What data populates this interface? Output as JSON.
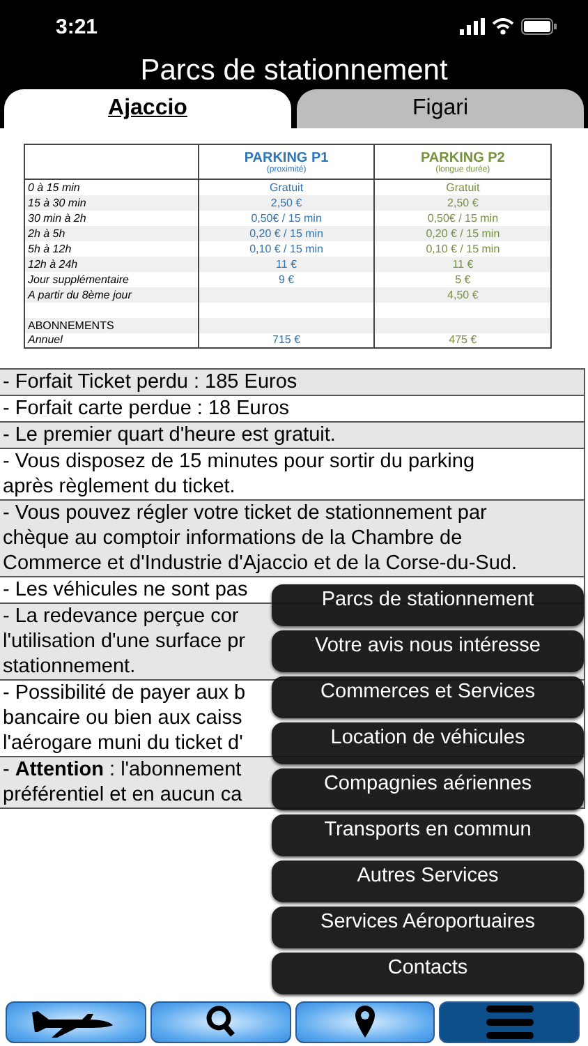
{
  "status_bar": {
    "time": "3:21"
  },
  "header": {
    "title": "Parcs de stationnement"
  },
  "tabs": [
    {
      "label": "Ajaccio",
      "selected": true
    },
    {
      "label": "Figari",
      "selected": false
    }
  ],
  "tariff_table": {
    "columns": [
      {
        "title": "PARKING P1",
        "subtitle": "(proximité)",
        "color": "#2e75b6"
      },
      {
        "title": "PARKING P2",
        "subtitle": "(longue durée)",
        "color": "#76923c"
      }
    ],
    "rows": [
      {
        "label": "0 à 15 min",
        "p1": "Gratuit",
        "p2": "Gratuit"
      },
      {
        "label": "15 à 30 min",
        "p1": "2,50 €",
        "p2": "2,50 €"
      },
      {
        "label": "30 min à 2h",
        "p1": "0,50€ / 15 min",
        "p2": "0,50€ / 15 min"
      },
      {
        "label": "2h à 5h",
        "p1": "0,20 € / 15 min",
        "p2": "0,20 € / 15 min"
      },
      {
        "label": "5h à 12h",
        "p1": "0,10 € / 15 min",
        "p2": "0,10 € / 15 min"
      },
      {
        "label": "12h à 24h",
        "p1": "11 €",
        "p2": "11 €"
      },
      {
        "label": "Jour supplémentaire",
        "p1": "9 €",
        "p2": "5 €"
      },
      {
        "label": "A partir du 8ème jour",
        "p2": "4,50 €"
      },
      {
        "kind": "spacer"
      },
      {
        "label": "ABONNEMENTS",
        "kind": "heading"
      },
      {
        "label": "Annuel",
        "p1": "715 €",
        "p2": "475 €"
      }
    ]
  },
  "notes": [
    {
      "lines": [
        "- Forfait Ticket perdu : 185 Euros"
      ]
    },
    {
      "lines": [
        "- Forfait carte perdue : 18 Euros"
      ]
    },
    {
      "lines": [
        "- Le premier quart d'heure est gratuit."
      ]
    },
    {
      "lines": [
        "- Vous disposez de 15 minutes pour sortir du parking",
        "après règlement du ticket."
      ]
    },
    {
      "lines": [
        "- Vous pouvez régler votre ticket de stationnement par",
        "chèque au comptoir informations de la Chambre de",
        "Commerce et d'Industrie d'Ajaccio et de la Corse-du-Sud."
      ]
    },
    {
      "lines": [
        "- Les véhicules ne sont pas"
      ]
    },
    {
      "lines": [
        "- La redevance perçue cor",
        "l'utilisation d'une surface pr",
        "stationnement."
      ]
    },
    {
      "lines": [
        "- Possibilité de payer aux b",
        "bancaire ou bien aux caiss",
        "l'aérogare muni du ticket d'"
      ]
    },
    {
      "lines": [
        "- **Attention** : l'abonnement",
        "préférentiel et en aucun ca"
      ]
    }
  ],
  "menu": [
    "Parcs de stationnement",
    "Votre avis nous intéresse",
    "Commerces et Services",
    "Location de véhicules",
    "Compagnies aériennes",
    "Transports en commun",
    "Autres Services",
    "Services Aéroportuaires",
    "Contacts"
  ],
  "bottom_bar": [
    {
      "kind": "plane",
      "selected": false
    },
    {
      "kind": "search",
      "selected": false
    },
    {
      "kind": "pin",
      "selected": false
    },
    {
      "kind": "menu",
      "selected": true
    }
  ]
}
